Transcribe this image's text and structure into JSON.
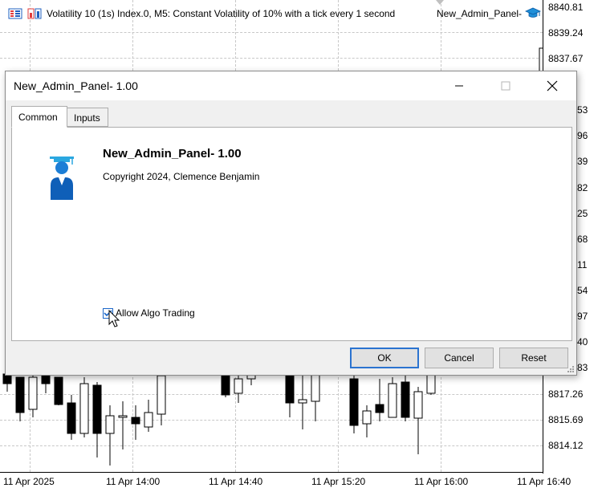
{
  "chart": {
    "symbol_text": "Volatility 10 (1s) Index.0, M5:  Constant Volatility of 10% with a tick every 1 second",
    "ea_name": "New_Admin_Panel-",
    "price_labels": [
      "8840.81",
      "8839.24",
      "8837.67",
      "53",
      "96",
      "39",
      "82",
      "25",
      "68",
      "11",
      "54",
      "97",
      "40",
      "83",
      "8817.26",
      "8815.69",
      "8814.12"
    ],
    "time_labels": [
      "11 Apr 2025",
      "11 Apr 14:00",
      "11 Apr 14:40",
      "11 Apr 15:20",
      "11 Apr 16:00",
      "11 Apr 16:40"
    ],
    "colors": {
      "bull": "#ffffff",
      "bear": "#000000",
      "grid": "#c8c8c8"
    }
  },
  "dialog": {
    "title": "New_Admin_Panel- 1.00",
    "tabs": [
      "Common",
      "Inputs"
    ],
    "active_tab": "Common",
    "app_name": "New_Admin_Panel- 1.00",
    "copyright": "Copyright 2024, Clemence Benjamin",
    "allow_algo_label": "Allow Algo Trading",
    "allow_algo_checked": true,
    "buttons": {
      "ok": "OK",
      "cancel": "Cancel",
      "reset": "Reset"
    },
    "accent": "#2b73d0"
  }
}
